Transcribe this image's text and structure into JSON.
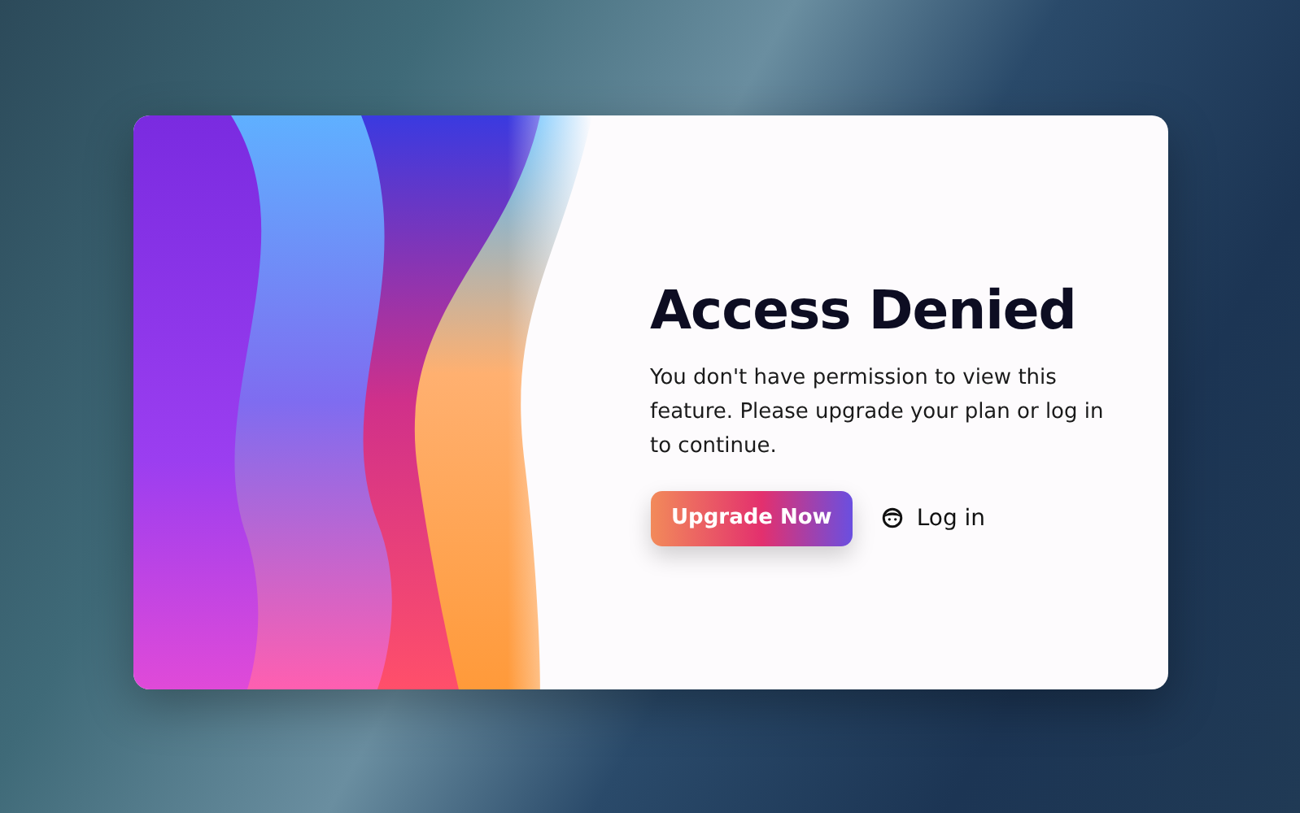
{
  "dialog": {
    "title": "Access Denied",
    "message": "You don't have permission to view this feature. Please upgrade your plan or log in to continue.",
    "buttons": [
      {
        "kind": "primary",
        "label": "Upgrade Now"
      },
      {
        "kind": "link",
        "label": "Log in"
      }
    ]
  }
}
